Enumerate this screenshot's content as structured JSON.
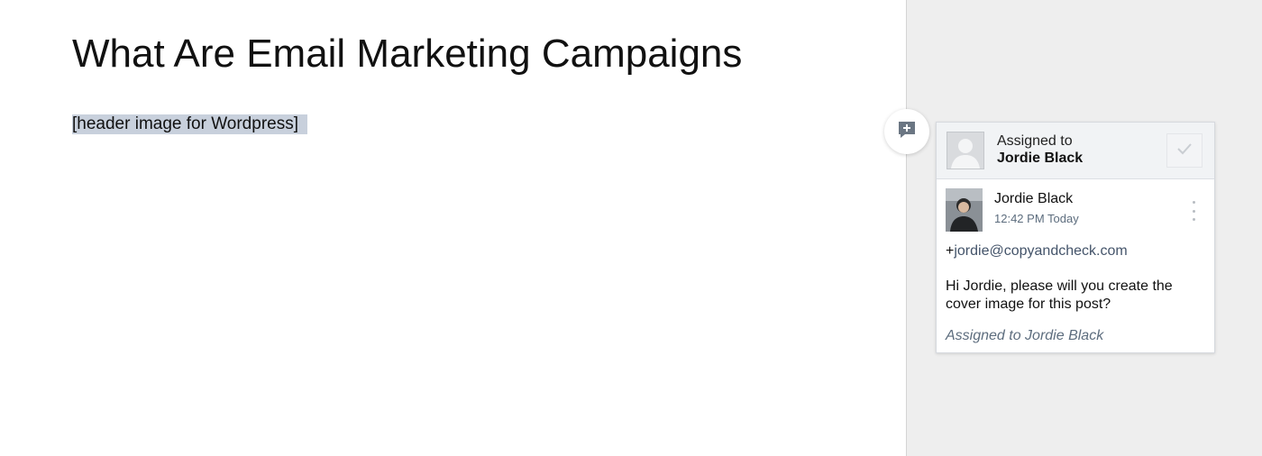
{
  "document": {
    "title": "What Are Email Marketing Campaigns",
    "selected_text": "[header image for Wordpress]"
  },
  "sidebar": {
    "add_comment_icon": "add-comment-icon",
    "card": {
      "header": {
        "assigned_label": "Assigned to",
        "assignee_name": "Jordie Black",
        "avatar_icon": "default-avatar-icon",
        "resolve_icon": "checkmark-icon"
      },
      "comment": {
        "author": "Jordie Black",
        "time": "12:42 PM Today",
        "mention_plus": "+",
        "mention_email": "jordie@copyandcheck.com",
        "text": "Hi Jordie, please will you create the cover image for this post?",
        "footer": "Assigned to Jordie Black",
        "more_icon": "more-vertical-icon"
      }
    }
  },
  "colors": {
    "selection": "#c8d0dc",
    "sidebar_bg": "#eeeeee",
    "muted_text": "#5d6d7e"
  }
}
